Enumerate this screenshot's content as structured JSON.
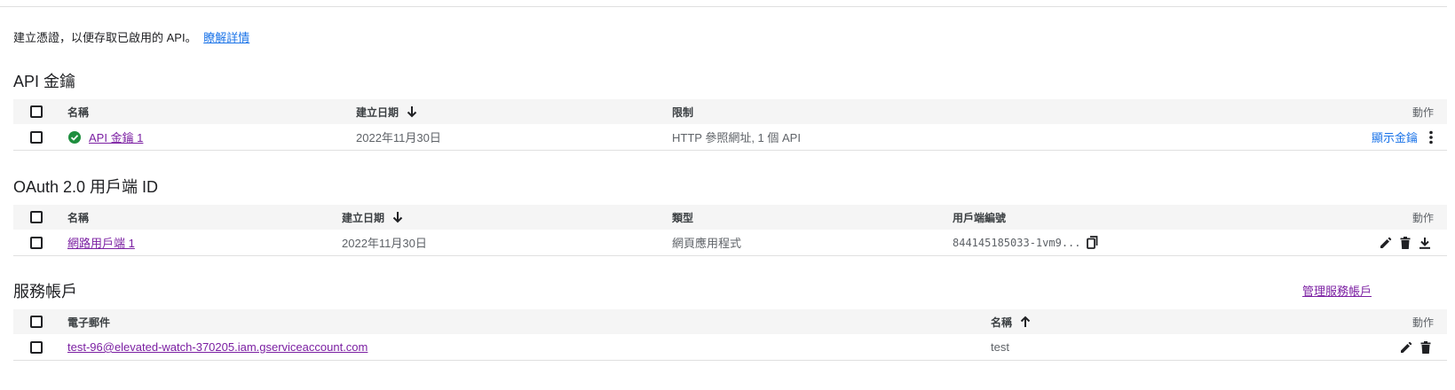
{
  "intro": {
    "text": "建立憑證，以便存取已啟用的 API。",
    "link": "瞭解詳情"
  },
  "api_keys": {
    "title": "API 金鑰",
    "headers": {
      "name": "名稱",
      "created": "建立日期",
      "restrictions": "限制",
      "actions": "動作"
    },
    "rows": [
      {
        "name": "API 金鑰 1",
        "created": "2022年11月30日",
        "restrictions": "HTTP 參照網址, 1 個 API",
        "action_link": "顯示金鑰"
      }
    ]
  },
  "oauth": {
    "title": "OAuth 2.0 用戶端 ID",
    "headers": {
      "name": "名稱",
      "created": "建立日期",
      "type": "類型",
      "client_id": "用戶端編號",
      "actions": "動作"
    },
    "rows": [
      {
        "name": "網路用戶端 1",
        "created": "2022年11月30日",
        "type": "網頁應用程式",
        "client_id": "844145185033-1vm9..."
      }
    ]
  },
  "service_accounts": {
    "title": "服務帳戶",
    "manage_link": "管理服務帳戶",
    "headers": {
      "email": "電子郵件",
      "name": "名稱",
      "actions": "動作"
    },
    "rows": [
      {
        "email": "test-96@elevated-watch-370205.iam.gserviceaccount.com",
        "name": "test"
      }
    ]
  },
  "colors": {
    "link_purple": "#7b1fa2",
    "link_blue": "#1a73e8",
    "status_green": "#1e8e3e"
  }
}
